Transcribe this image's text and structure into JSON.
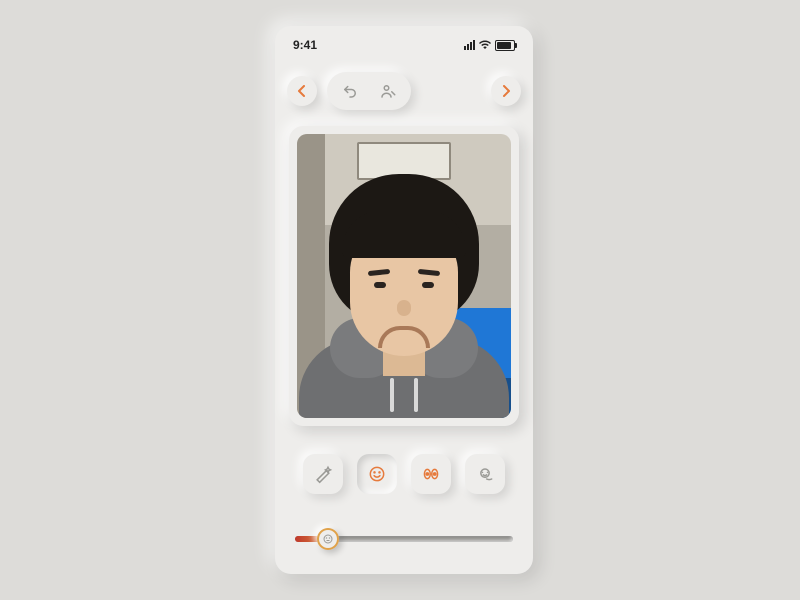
{
  "status": {
    "time": "9:41"
  },
  "nav": {
    "back_icon": "triangle-left",
    "undo_icon": "undo",
    "zoom_icon": "person-zoom",
    "play_icon": "triangle-right"
  },
  "tools": [
    {
      "id": "magic",
      "icon": "magic-wand",
      "active": false
    },
    {
      "id": "smile",
      "icon": "smile-face",
      "active": true
    },
    {
      "id": "eyes",
      "icon": "eyes",
      "active": false
    },
    {
      "id": "face3d",
      "icon": "face-scan",
      "active": false
    }
  ],
  "slider": {
    "value_pct": 15,
    "thumb_icon": "neutral-face"
  },
  "colors": {
    "accent": "#e67a3c"
  }
}
